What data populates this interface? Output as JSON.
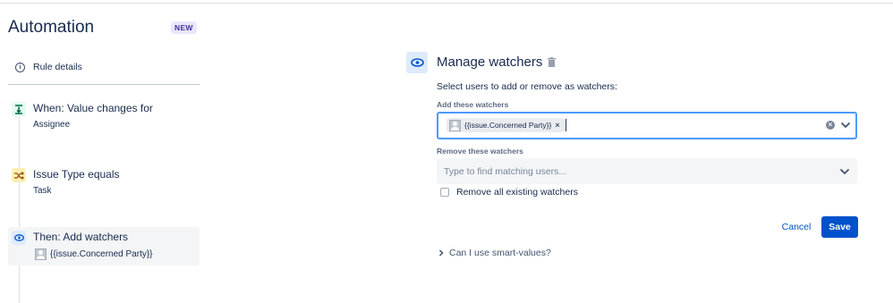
{
  "sidebar": {
    "title": "Automation",
    "badge": "NEW",
    "rule_details": "Rule details",
    "steps": [
      {
        "title": "When: Value changes for",
        "subtitle": "Assignee",
        "icon": "trigger-icon"
      },
      {
        "title": "Issue Type equals",
        "subtitle": "Task",
        "icon": "condition-shuffle-icon"
      },
      {
        "title": "Then: Add watchers",
        "subtitle": "{{issue.Concerned Party}}",
        "icon": "eye-icon"
      }
    ]
  },
  "main": {
    "title": "Manage watchers",
    "description": "Select users to add or remove as watchers:",
    "add_label": "Add these watchers",
    "add_chip": "{{issue.Concerned Party}}",
    "remove_label": "Remove these watchers",
    "remove_placeholder": "Type to find matching users...",
    "remove_all_label": "Remove all existing watchers",
    "remove_all_checked": false,
    "cancel_label": "Cancel",
    "save_label": "Save",
    "smart_values_label": "Can I use smart-values?"
  },
  "colors": {
    "primary": "#0052cc",
    "focus_border": "#4c9aff",
    "new_badge_bg": "#eae6ff",
    "new_badge_text": "#403294",
    "trigger_icon_bg": "#e3fcef",
    "condition_icon_bg": "#fff0b3",
    "action_icon_bg": "#deebff"
  }
}
